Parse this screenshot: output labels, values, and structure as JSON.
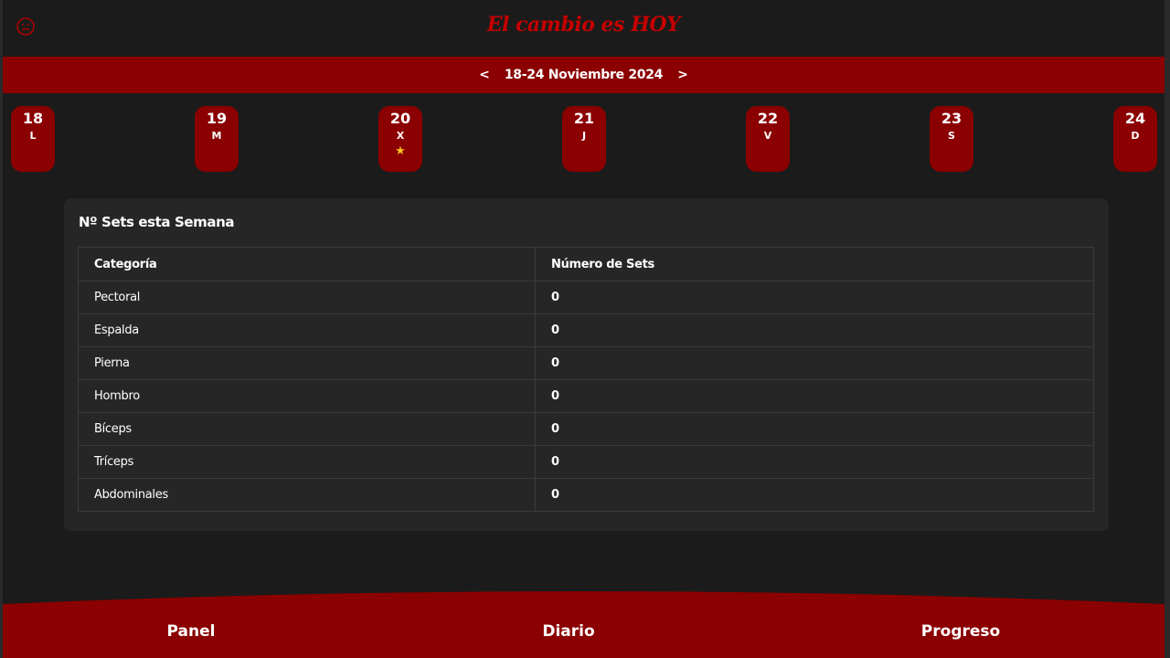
{
  "header": {
    "title": "El cambio es HOY",
    "profile_icon": "user-circle-icon",
    "title_color": "#c40000"
  },
  "week": {
    "label": "18-24 Noviembre 2024",
    "prev_label": "<",
    "next_label": ">",
    "bar_color": "#8b0000"
  },
  "days": [
    {
      "num": "18",
      "letter": "L"
    },
    {
      "num": "19",
      "letter": "M"
    },
    {
      "num": "20",
      "letter": "X",
      "today": true
    },
    {
      "num": "21",
      "letter": "J"
    },
    {
      "num": "22",
      "letter": "V"
    },
    {
      "num": "23",
      "letter": "S"
    },
    {
      "num": "24",
      "letter": "D"
    }
  ],
  "today_marker": "★",
  "today_marker_color": "#f5c518",
  "card": {
    "title": "Nº Sets esta Semana",
    "columns": [
      "Categoría",
      "Número de Sets"
    ],
    "rows": [
      {
        "category": "Pectoral",
        "sets": "0"
      },
      {
        "category": "Espalda",
        "sets": "0"
      },
      {
        "category": "Pierna",
        "sets": "0"
      },
      {
        "category": "Hombro",
        "sets": "0"
      },
      {
        "category": "Bíceps",
        "sets": "0"
      },
      {
        "category": "Tríceps",
        "sets": "0"
      },
      {
        "category": "Abdominales",
        "sets": "0"
      }
    ]
  },
  "footer": {
    "nav": [
      {
        "label": "Panel"
      },
      {
        "label": "Diario"
      },
      {
        "label": "Progreso"
      }
    ]
  }
}
